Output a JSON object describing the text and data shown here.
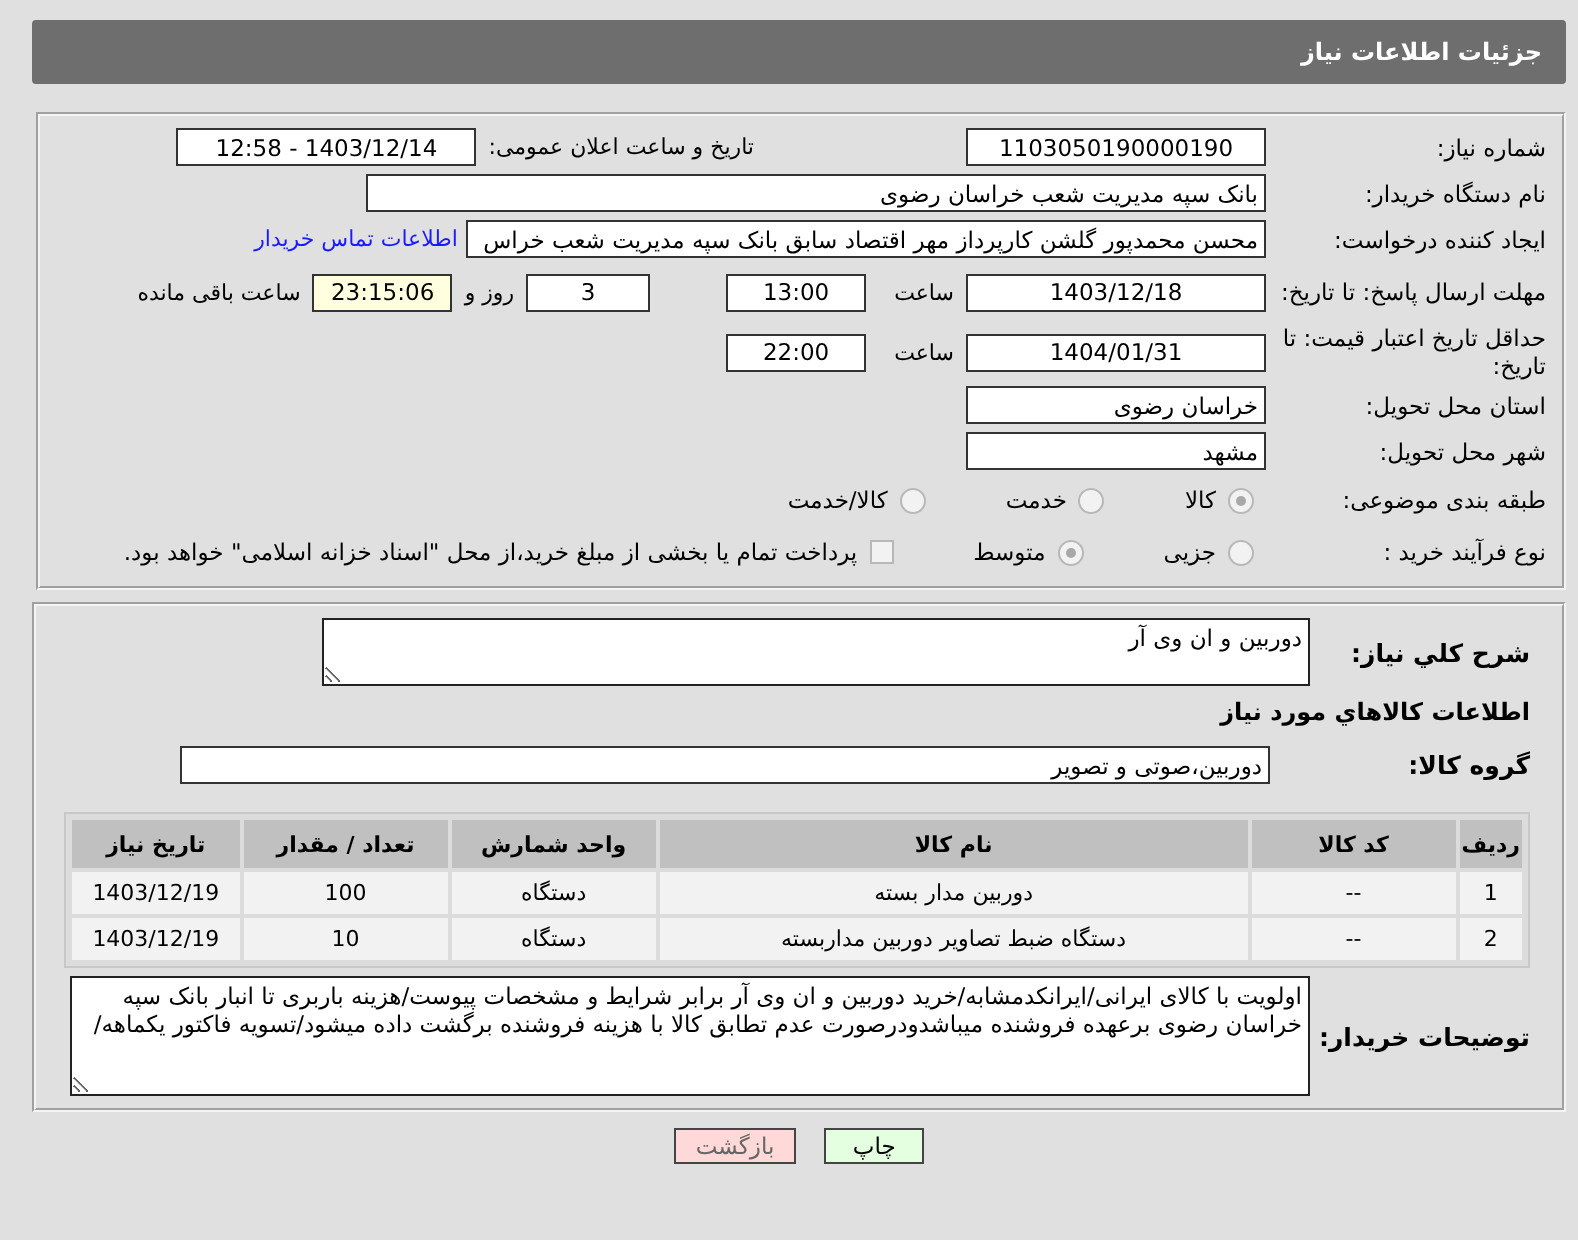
{
  "header": {
    "title": "جزئیات اطلاعات نیاز"
  },
  "need_number": {
    "label": "شماره نیاز:",
    "value": "1103050190000190"
  },
  "announce": {
    "label": "تاریخ و ساعت اعلان عمومی:",
    "value": "1403/12/14 - 12:58"
  },
  "buyer_org": {
    "label": "نام دستگاه خریدار:",
    "value": "بانک سپه مدیریت شعب خراسان رضوی"
  },
  "requester": {
    "label": "ایجاد کننده درخواست:",
    "value": "محسن محمدپور گلشن کارپرداز مهر اقتصاد سابق بانک سپه مدیریت شعب خراس",
    "link": "اطلاعات تماس خریدار"
  },
  "deadline": {
    "label": "مهلت ارسال پاسخ: تا تاریخ:",
    "date": "1403/12/18",
    "time_label": "ساعت",
    "time": "13:00",
    "days": "3",
    "days_label": "روز و",
    "remaining": "23:15:06",
    "remaining_label": "ساعت باقی مانده"
  },
  "validity": {
    "label": "حداقل تاریخ اعتبار قیمت: تا تاریخ:",
    "date": "1404/01/31",
    "time_label": "ساعت",
    "time": "22:00"
  },
  "province": {
    "label": "استان محل تحویل:",
    "value": "خراسان رضوی"
  },
  "city": {
    "label": "شهر محل تحویل:",
    "value": "مشهد"
  },
  "category": {
    "label": "طبقه بندی موضوعی:",
    "options": [
      {
        "label": "کالا",
        "selected": true
      },
      {
        "label": "خدمت",
        "selected": false
      },
      {
        "label": "کالا/خدمت",
        "selected": false
      }
    ]
  },
  "process": {
    "label": "نوع فرآیند خرید :",
    "options": [
      {
        "label": "جزیی",
        "selected": false
      },
      {
        "label": "متوسط",
        "selected": true
      }
    ],
    "treasury": {
      "label": "پرداخت تمام یا بخشی از مبلغ خرید،از محل \"اسناد خزانه اسلامی\" خواهد بود.",
      "checked": false
    }
  },
  "description": {
    "label": "شرح کلي نياز:",
    "value": "دوربین و ان وی آر"
  },
  "goods_title": "اطلاعات کالاهاي مورد نياز",
  "goods_group": {
    "label": "گروه کالا:",
    "value": "دوربین،صوتی و تصویر"
  },
  "items_table": {
    "columns": [
      "ردیف",
      "کد کالا",
      "نام کالا",
      "واحد شمارش",
      "تعداد / مقدار",
      "تاریخ نیاز"
    ],
    "rows": [
      [
        "1",
        "--",
        "دوربین مدار بسته",
        "دستگاه",
        "100",
        "1403/12/19"
      ],
      [
        "2",
        "--",
        "دستگاه ضبط تصاویر دوربین مداربسته",
        "دستگاه",
        "10",
        "1403/12/19"
      ]
    ]
  },
  "buyer_notes": {
    "label": "توضیحات خریدار:",
    "value": "اولویت با کالای ایرانی/ایرانکدمشابه/خرید دوربین و ان وی آر برابر شرایط و مشخصات پیوست/هزینه باربری تا انبار بانک سپه خراسان رضوی برعهده فروشنده میباشدودرصورت عدم تطابق کالا با هزینه فروشنده برگشت داده میشود/تسویه فاکتور یکماهه/"
  },
  "buttons": [
    {
      "label": "چاپ",
      "kind": "print"
    },
    {
      "label": "بازگشت",
      "kind": "back"
    }
  ]
}
